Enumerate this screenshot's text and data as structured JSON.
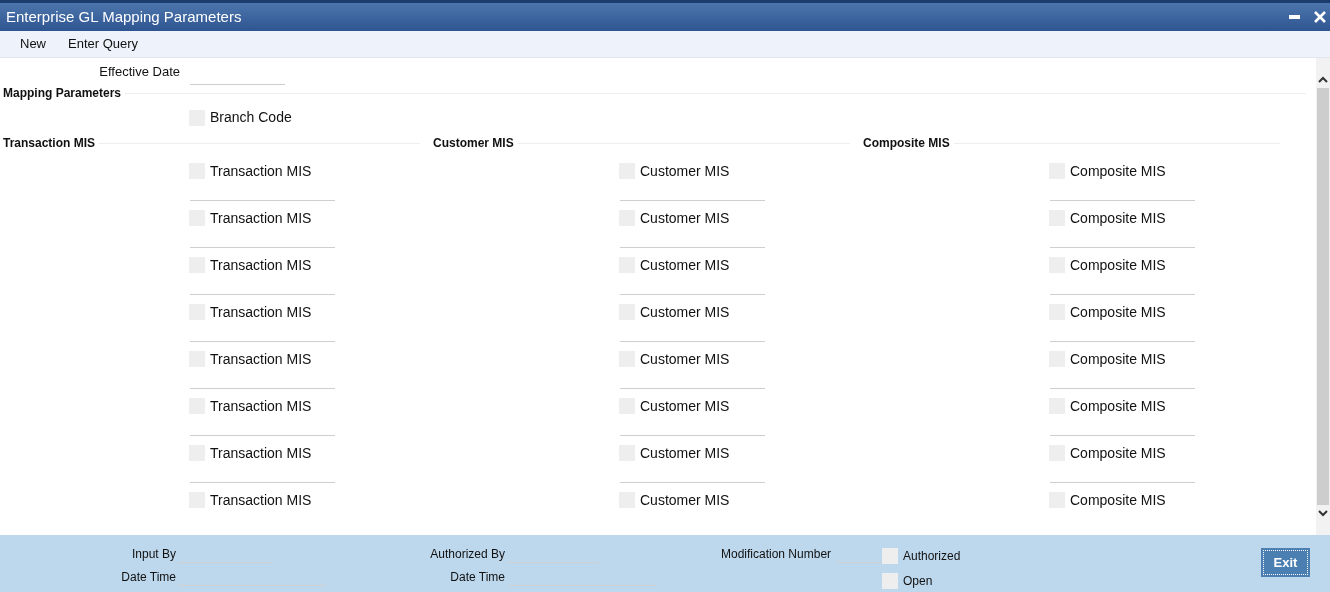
{
  "window": {
    "title": "Enterprise GL Mapping Parameters"
  },
  "toolbar": [
    "New",
    "Enter Query"
  ],
  "effective_date": {
    "label": "Effective Date"
  },
  "mapping_parameters": {
    "heading": "Mapping Parameters",
    "branch_code": {
      "label": "Branch Code",
      "checked": false
    }
  },
  "sections": [
    {
      "heading": "Transaction MIS",
      "items": [
        {
          "label": "Transaction MIS",
          "checked": false
        },
        {
          "label": "Transaction MIS",
          "checked": false
        },
        {
          "label": "Transaction MIS",
          "checked": false
        },
        {
          "label": "Transaction MIS",
          "checked": false
        },
        {
          "label": "Transaction MIS",
          "checked": false
        },
        {
          "label": "Transaction MIS",
          "checked": false
        },
        {
          "label": "Transaction MIS",
          "checked": false
        },
        {
          "label": "Transaction MIS",
          "checked": false
        }
      ]
    },
    {
      "heading": "Customer MIS",
      "items": [
        {
          "label": "Customer MIS",
          "checked": false
        },
        {
          "label": "Customer MIS",
          "checked": false
        },
        {
          "label": "Customer MIS",
          "checked": false
        },
        {
          "label": "Customer MIS",
          "checked": false
        },
        {
          "label": "Customer MIS",
          "checked": false
        },
        {
          "label": "Customer MIS",
          "checked": false
        },
        {
          "label": "Customer MIS",
          "checked": false
        },
        {
          "label": "Customer MIS",
          "checked": false
        }
      ]
    },
    {
      "heading": "Composite MIS",
      "items": [
        {
          "label": "Composite MIS",
          "checked": false
        },
        {
          "label": "Composite MIS",
          "checked": false
        },
        {
          "label": "Composite MIS",
          "checked": false
        },
        {
          "label": "Composite MIS",
          "checked": false
        },
        {
          "label": "Composite MIS",
          "checked": false
        },
        {
          "label": "Composite MIS",
          "checked": false
        },
        {
          "label": "Composite MIS",
          "checked": false
        },
        {
          "label": "Composite MIS",
          "checked": false
        }
      ]
    }
  ],
  "footer": {
    "input_by": "Input By",
    "input_date_time": "Date Time",
    "authorized_by": "Authorized By",
    "auth_date_time": "Date Time",
    "modification_number": "Modification Number",
    "authorized": {
      "label": "Authorized",
      "checked": false
    },
    "open": {
      "label": "Open",
      "checked": false
    },
    "exit": "Exit"
  }
}
